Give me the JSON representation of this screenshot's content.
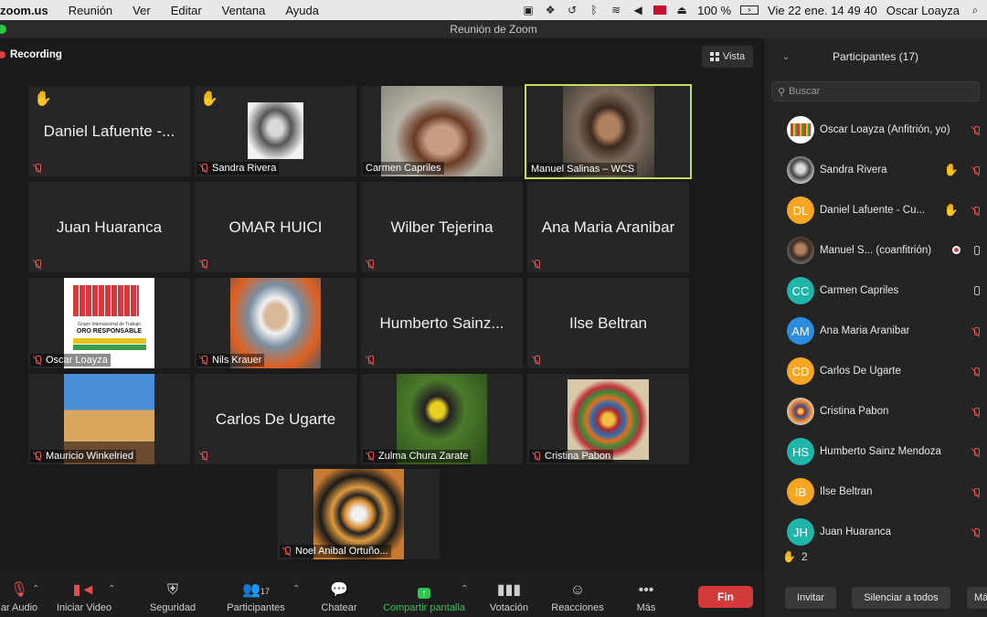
{
  "menubar": {
    "app": "zoom.us",
    "menus": [
      "Reunión",
      "Ver",
      "Editar",
      "Ventana",
      "Ayuda"
    ],
    "battery": "100 %",
    "datetime": "Vie 22 ene.  14 49 40",
    "user": "Oscar Loayza"
  },
  "window": {
    "title": "Reunión de Zoom"
  },
  "stage": {
    "recording_label": "Recording",
    "view_label": "Vista",
    "tiles": [
      {
        "big_name": "Daniel Lafuente -...",
        "label": "",
        "hand": true,
        "photo": false
      },
      {
        "big_name": "",
        "label": "Sandra Rivera",
        "hand": true,
        "photo": true
      },
      {
        "big_name": "",
        "label": "Carmen Capriles",
        "hand": false,
        "photo": true
      },
      {
        "big_name": "",
        "label": "Manuel Salinas – WCS",
        "hand": false,
        "photo": true,
        "active": true
      },
      {
        "big_name": "Juan Huaranca",
        "label": "",
        "photo": false
      },
      {
        "big_name": "OMAR HUICI",
        "label": "",
        "photo": false
      },
      {
        "big_name": "Wilber Tejerina",
        "label": "",
        "photo": false
      },
      {
        "big_name": "Ana Maria Aranibar",
        "label": "",
        "photo": false
      },
      {
        "big_name": "",
        "label": "Oscar Loayza",
        "photo": true
      },
      {
        "big_name": "",
        "label": "Nils Krauer",
        "photo": true
      },
      {
        "big_name": "Humberto Sainz...",
        "label": "",
        "photo": false
      },
      {
        "big_name": "Ilse Beltran",
        "label": "",
        "photo": false
      },
      {
        "big_name": "",
        "label": "Mauricio Winkelried",
        "photo": true
      },
      {
        "big_name": "Carlos De Ugarte",
        "label": "",
        "photo": false
      },
      {
        "big_name": "",
        "label": "Zulma Chura Zarate",
        "photo": true
      },
      {
        "big_name": "",
        "label": "Cristina Pabon",
        "photo": true
      },
      {
        "big_name": "",
        "label": "Noel Anibal Ortuño...",
        "photo": true
      }
    ],
    "logo_text_small": "Grupo Internacional de Trabajo",
    "logo_text_big": "ORO RESPONSABLE"
  },
  "toolbar": {
    "audio": "ar Audio",
    "video": "Iniciar Video",
    "security": "Seguridad",
    "participants": "Participantes",
    "participants_count": "17",
    "chat": "Chatear",
    "share": "Compartir pantalla",
    "poll": "Votación",
    "reactions": "Reacciones",
    "more": "Más",
    "end": "Fin"
  },
  "panel": {
    "title": "Participantes (17)",
    "search_placeholder": "Buscar",
    "participants": [
      {
        "name": "Oscar Loayza  (Anfitrión, yo)",
        "initials": "",
        "color": "#ffffff",
        "hand": false,
        "mic": "off"
      },
      {
        "name": "Sandra Rivera",
        "initials": "",
        "color": "#555555",
        "hand": true,
        "mic": "off"
      },
      {
        "name": "Daniel Lafuente - Cu...",
        "initials": "DL",
        "color": "#f5a623",
        "hand": true,
        "mic": "off"
      },
      {
        "name": "Manuel S...  (coanfitrión)",
        "initials": "",
        "color": "#555555",
        "hand": false,
        "mic": "on",
        "recording": true
      },
      {
        "name": "Carmen Capriles",
        "initials": "CC",
        "color": "#1fb5a8",
        "hand": false,
        "mic": "on"
      },
      {
        "name": "Ana Maria Aranibar",
        "initials": "AM",
        "color": "#2d8ce0",
        "hand": false,
        "mic": "off"
      },
      {
        "name": "Carlos De Ugarte",
        "initials": "CD",
        "color": "#f5a623",
        "hand": false,
        "mic": "off"
      },
      {
        "name": "Cristina Pabon",
        "initials": "",
        "color": "#b86a2a",
        "hand": false,
        "mic": "off"
      },
      {
        "name": "Humberto Sainz Mendoza",
        "initials": "HS",
        "color": "#1fb5a8",
        "hand": false,
        "mic": "off"
      },
      {
        "name": "Ilse Beltran",
        "initials": "IB",
        "color": "#f5a623",
        "hand": false,
        "mic": "off"
      },
      {
        "name": "Juan Huaranca",
        "initials": "JH",
        "color": "#1fb5a8",
        "hand": false,
        "mic": "off"
      }
    ],
    "raised_hands": "2",
    "invite": "Invitar",
    "mute_all": "Silenciar a todos",
    "more": "Má"
  }
}
